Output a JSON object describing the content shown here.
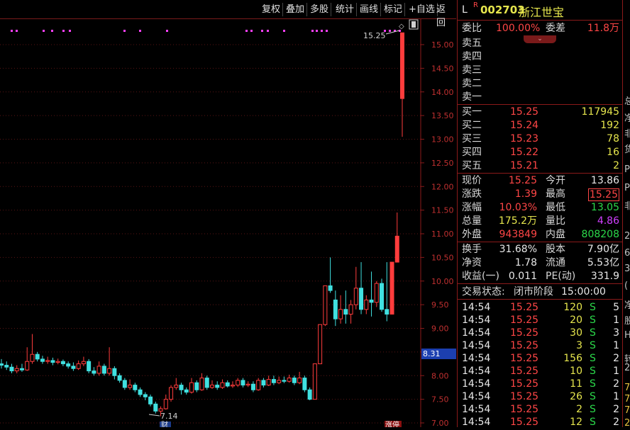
{
  "toolbar": {
    "buttons": [
      "复权",
      "叠加",
      "多股",
      "统计",
      "画线",
      "标记",
      "+自选",
      "返回"
    ]
  },
  "chart": {
    "y_ticks": [
      "15.00",
      "14.50",
      "14.00",
      "13.50",
      "13.00",
      "12.50",
      "12.00",
      "11.50",
      "11.00",
      "10.50",
      "10.00",
      "9.50",
      "9.00",
      "8.50",
      "8.00",
      "7.50",
      "7.00"
    ],
    "high_label": "15.25",
    "low_label": "7.14",
    "current_price_tag": "8.31",
    "event_marker": "财",
    "limit_marker": "涨停"
  },
  "stock": {
    "flag": "L",
    "sup": "R",
    "code": "002703",
    "name": "浙江世宝"
  },
  "order": {
    "weibi_label": "委比",
    "weibi": "100.00%",
    "weicha_label": "委差",
    "weicha": "11.8万"
  },
  "sell": [
    {
      "label": "卖五"
    },
    {
      "label": "卖四"
    },
    {
      "label": "卖三"
    },
    {
      "label": "卖二"
    },
    {
      "label": "卖一"
    }
  ],
  "buy": [
    {
      "label": "买一",
      "price": "15.25",
      "vol": "117945"
    },
    {
      "label": "买二",
      "price": "15.24",
      "vol": "192"
    },
    {
      "label": "买三",
      "price": "15.23",
      "vol": "78"
    },
    {
      "label": "买四",
      "price": "15.22",
      "vol": "16"
    },
    {
      "label": "买五",
      "price": "15.21",
      "vol": "2"
    }
  ],
  "quote": {
    "xianjia_l": "现价",
    "xianjia": "15.25",
    "jinkai_l": "今开",
    "jinkai": "13.86",
    "zhangdie_l": "涨跌",
    "zhangdie": "1.39",
    "zuigao_l": "最高",
    "zuigao": "15.25",
    "zhangfu_l": "涨幅",
    "zhangfu": "10.03%",
    "zuidi_l": "最低",
    "zuidi": "13.05",
    "zongliang_l": "总量",
    "zongliang": "175.2万",
    "liangbi_l": "量比",
    "liangbi": "4.86",
    "waipan_l": "外盘",
    "waipan": "943849",
    "neipan_l": "内盘",
    "neipan": "808208"
  },
  "fund": {
    "huanshou_l": "换手",
    "huanshou": "31.68%",
    "guben_l": "股本",
    "guben": "7.90亿",
    "jingzi_l": "净资",
    "jingzi": "1.78",
    "liutong_l": "流通",
    "liutong": "5.53亿",
    "shouyi_l": "收益(一)",
    "shouyi": "0.011",
    "pe_l": "PE(动)",
    "pe": "331.9"
  },
  "status": {
    "label": "交易状态:",
    "state": "闭市阶段",
    "time": "15:00:00"
  },
  "trades": [
    {
      "time": "14:54",
      "price": "15.25",
      "vol": "120",
      "side": "S",
      "n": "5"
    },
    {
      "time": "14:54",
      "price": "15.25",
      "vol": "20",
      "side": "S",
      "n": "1"
    },
    {
      "time": "14:54",
      "price": "15.25",
      "vol": "30",
      "side": "S",
      "n": "3"
    },
    {
      "time": "14:54",
      "price": "15.25",
      "vol": "3",
      "side": "S",
      "n": "1"
    },
    {
      "time": "14:54",
      "price": "15.25",
      "vol": "156",
      "side": "S",
      "n": "2"
    },
    {
      "time": "14:54",
      "price": "15.25",
      "vol": "10",
      "side": "S",
      "n": "1"
    },
    {
      "time": "14:54",
      "price": "15.25",
      "vol": "11",
      "side": "S",
      "n": "2"
    },
    {
      "time": "14:54",
      "price": "15.25",
      "vol": "26",
      "side": "S",
      "n": "1"
    },
    {
      "time": "14:54",
      "price": "15.25",
      "vol": "2",
      "side": "S",
      "n": "2"
    },
    {
      "time": "14:54",
      "price": "15.25",
      "vol": "12",
      "side": "S",
      "n": "2"
    }
  ],
  "edge_chars": [
    "总",
    "净",
    "非",
    "货",
    "P",
    "P",
    "非",
    "2",
    "6",
    "3",
    "(",
    "净",
    "股",
    "H",
    "转",
    "2",
    "7",
    "7",
    "7",
    "2"
  ],
  "colors": {
    "up": "#ff3c3c",
    "down": "#40e0e0",
    "border": "#8b1a1a",
    "magenta": "#ff40ff"
  },
  "chart_data": {
    "type": "candlestick",
    "y_range": [
      7.0,
      15.3
    ],
    "candles": [
      [
        8.25,
        8.22,
        8.35,
        8.15
      ],
      [
        8.22,
        8.18,
        8.3,
        8.12
      ],
      [
        8.18,
        8.1,
        8.25,
        8.05
      ],
      [
        8.1,
        8.15,
        8.22,
        8.05
      ],
      [
        8.15,
        8.12,
        8.25,
        8.08
      ],
      [
        8.12,
        8.3,
        8.6,
        8.1
      ],
      [
        8.3,
        8.45,
        8.88,
        8.25
      ],
      [
        8.45,
        8.35,
        8.5,
        8.3
      ],
      [
        8.35,
        8.3,
        8.42,
        8.25
      ],
      [
        8.3,
        8.32,
        8.4,
        8.25
      ],
      [
        8.32,
        8.28,
        8.38,
        8.22
      ],
      [
        8.28,
        8.3,
        8.36,
        8.24
      ],
      [
        8.3,
        8.25,
        8.34,
        8.2
      ],
      [
        8.25,
        8.2,
        8.3,
        8.15
      ],
      [
        8.2,
        8.15,
        8.28,
        8.1
      ],
      [
        8.15,
        8.25,
        8.32,
        8.12
      ],
      [
        8.25,
        8.3,
        8.4,
        8.2
      ],
      [
        8.3,
        8.1,
        8.35,
        8.05
      ],
      [
        8.1,
        8.05,
        8.18,
        8.0
      ],
      [
        8.05,
        8.2,
        8.3,
        8.0
      ],
      [
        8.2,
        8.05,
        8.25,
        8.0
      ],
      [
        8.05,
        8.15,
        8.6,
        8.0
      ],
      [
        8.15,
        8.0,
        8.2,
        7.92
      ],
      [
        8.0,
        7.9,
        8.05,
        7.85
      ],
      [
        7.9,
        7.75,
        7.95,
        7.7
      ],
      [
        7.75,
        7.8,
        7.92,
        7.7
      ],
      [
        7.8,
        7.7,
        7.85,
        7.65
      ],
      [
        7.7,
        7.6,
        7.75,
        7.55
      ],
      [
        7.6,
        7.55,
        7.65,
        7.48
      ],
      [
        7.55,
        7.4,
        7.6,
        7.35
      ],
      [
        7.4,
        7.25,
        7.45,
        7.2
      ],
      [
        7.25,
        7.3,
        7.35,
        7.14
      ],
      [
        7.3,
        7.5,
        7.6,
        7.28
      ],
      [
        7.5,
        7.75,
        7.8,
        7.45
      ],
      [
        7.75,
        7.8,
        7.95,
        7.7
      ],
      [
        7.8,
        7.7,
        7.85,
        7.6
      ],
      [
        7.7,
        7.65,
        7.75,
        7.6
      ],
      [
        7.65,
        7.85,
        7.95,
        7.62
      ],
      [
        7.85,
        7.7,
        7.9,
        7.65
      ],
      [
        7.7,
        7.95,
        8.05,
        7.68
      ],
      [
        7.95,
        7.75,
        8.0,
        7.7
      ],
      [
        7.75,
        7.8,
        7.9,
        7.72
      ],
      [
        7.8,
        7.75,
        7.88,
        7.7
      ],
      [
        7.75,
        7.85,
        7.92,
        7.72
      ],
      [
        7.85,
        7.78,
        7.9,
        7.75
      ],
      [
        7.78,
        7.8,
        7.88,
        7.74
      ],
      [
        7.8,
        7.9,
        7.95,
        7.76
      ],
      [
        7.9,
        7.8,
        7.95,
        7.75
      ],
      [
        7.8,
        7.82,
        7.88,
        7.76
      ],
      [
        7.82,
        7.7,
        7.88,
        7.65
      ],
      [
        7.7,
        7.9,
        7.95,
        7.68
      ],
      [
        7.9,
        7.8,
        7.95,
        7.75
      ],
      [
        7.8,
        7.92,
        8.0,
        7.78
      ],
      [
        7.92,
        7.85,
        8.0,
        7.8
      ],
      [
        7.85,
        7.9,
        7.98,
        7.82
      ],
      [
        7.9,
        7.88,
        7.98,
        7.84
      ],
      [
        7.88,
        7.95,
        8.02,
        7.85
      ],
      [
        7.95,
        7.85,
        8.0,
        7.8
      ],
      [
        7.85,
        7.95,
        8.08,
        7.82
      ],
      [
        7.95,
        7.7,
        8.0,
        7.65
      ],
      [
        7.7,
        7.5,
        7.75,
        7.48
      ],
      [
        7.5,
        8.25,
        8.25,
        7.5
      ],
      [
        8.25,
        9.08,
        9.08,
        8.25
      ],
      [
        9.08,
        9.9,
        9.9,
        9.05
      ],
      [
        9.9,
        9.8,
        10.5,
        9.75
      ],
      [
        9.6,
        9.2,
        9.8,
        9.05
      ],
      [
        9.2,
        9.4,
        9.7,
        9.1
      ],
      [
        9.4,
        9.3,
        9.8,
        9.1
      ],
      [
        9.3,
        9.5,
        9.6,
        9.1
      ],
      [
        9.5,
        9.85,
        10.3,
        9.4
      ],
      [
        9.85,
        9.4,
        10.4,
        9.3
      ],
      [
        9.4,
        9.6,
        9.7,
        9.3
      ],
      [
        9.6,
        9.55,
        10.2,
        9.25
      ],
      [
        9.55,
        9.95,
        10.0,
        9.45
      ],
      [
        9.95,
        9.4,
        10.05,
        9.35
      ],
      [
        9.4,
        9.3,
        10.4,
        9.15
      ],
      [
        9.3,
        10.4,
        10.4,
        9.3
      ],
      [
        10.4,
        10.95,
        11.45,
        10.45
      ],
      [
        13.86,
        15.25,
        15.25,
        13.05
      ]
    ]
  }
}
